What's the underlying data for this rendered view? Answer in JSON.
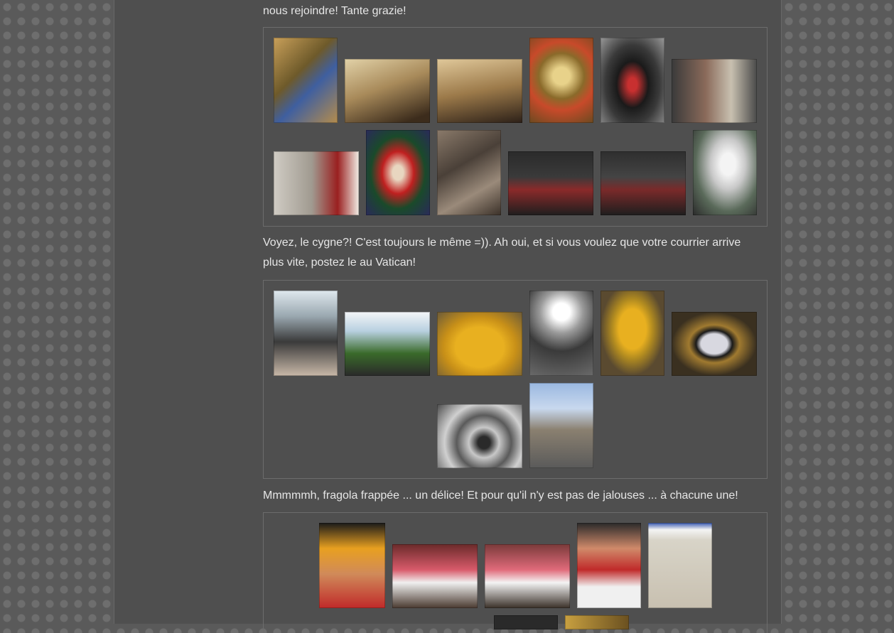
{
  "post": {
    "para_intro_tail": "nous rejoindre! Tante grazie!",
    "para_swan": "Voyez, le cygne?! C'est toujours le même =)). Ah oui, et si vous voulez que votre courrier arrive plus vite, postez le au Vatican!",
    "para_fragola": "Mmmmmh, fragola frappée ... un délice! Et pour qu'il n'y est pas de jalouses ... à chacune une!"
  },
  "palette": {
    "page_bg": "#5a5a5a",
    "column_bg": "#4f4f4f",
    "text": "#e6e6e6",
    "gallery_border": "#6c6c6c"
  }
}
